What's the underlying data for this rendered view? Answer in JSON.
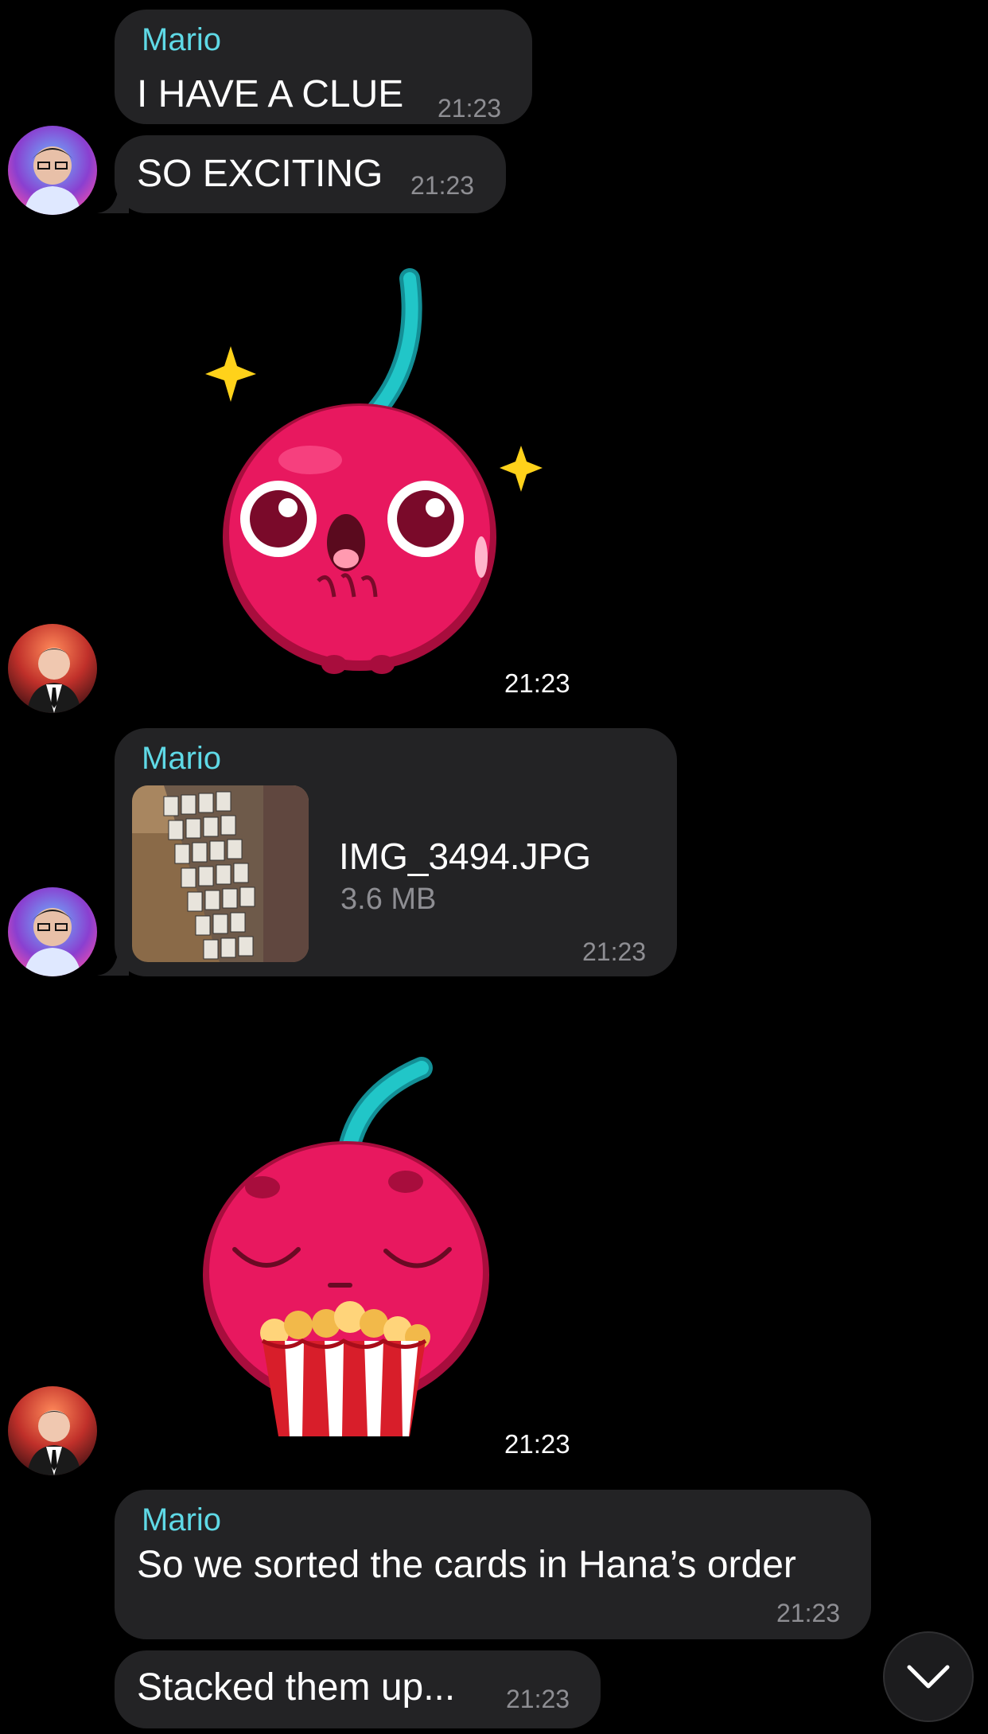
{
  "messages": [
    {
      "sender": "Mario",
      "text": "I HAVE A CLUE",
      "time": "21:23"
    },
    {
      "text": "SO EXCITING",
      "time": "21:23"
    },
    {
      "sticker": "cherry-sparkle-sticker",
      "time": "21:23"
    },
    {
      "sender": "Mario",
      "file": {
        "name": "IMG_3494.JPG",
        "size": "3.6 MB"
      },
      "time": "21:23"
    },
    {
      "sticker": "cherry-popcorn-sticker",
      "time": "21:23"
    },
    {
      "sender": "Mario",
      "text": "So we sorted the cards in Hana’s order",
      "time": "21:23"
    },
    {
      "text": "Stacked them up...",
      "time": "21:23"
    }
  ],
  "icons": {
    "scroll_down": "chevron-down-icon"
  },
  "colors": {
    "background": "#000000",
    "bubble": "#232325",
    "sender": "#5fd9e6",
    "time": "#8e8e93",
    "cherry": "#e8185f",
    "stem": "#1fc3c3"
  }
}
